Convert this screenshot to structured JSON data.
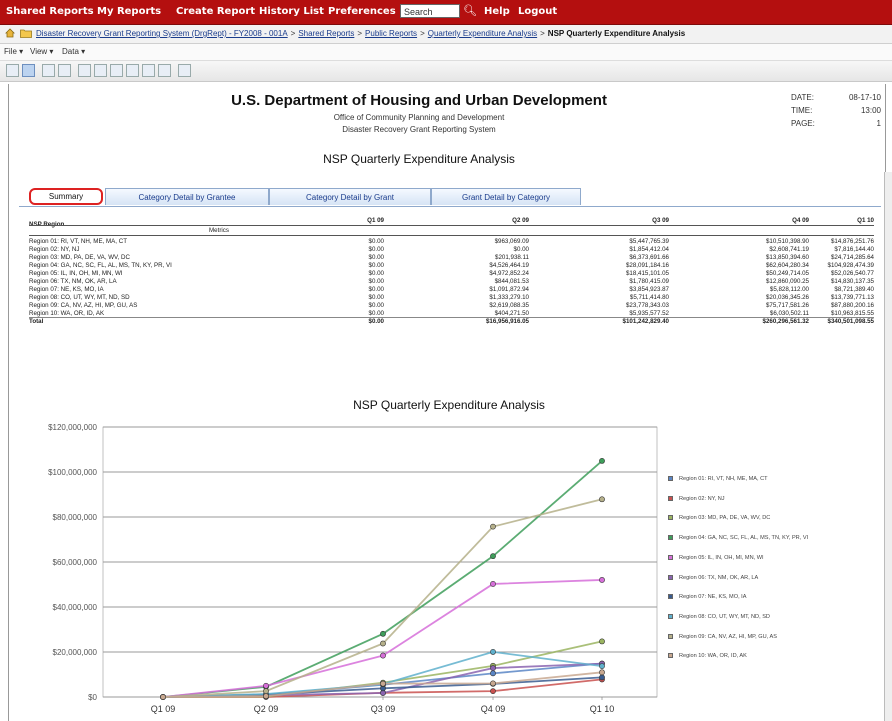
{
  "nav": {
    "items": [
      "Shared Reports",
      "My Reports",
      "Create Report",
      "History List",
      "Preferences"
    ],
    "search_placeholder": "Search",
    "help": "Help",
    "logout": "Logout"
  },
  "breadcrumb": {
    "links": [
      "Disaster Recovery Grant Reporting System (DrgRept) - FY2008 - 001A",
      "Shared Reports",
      "Public Reports",
      "Quarterly Expenditure Analysis"
    ],
    "current": "NSP Quarterly Expenditure Analysis",
    "separator": ">"
  },
  "menubar": {
    "file": "File ▾",
    "view": "View ▾",
    "data": "Data ▾"
  },
  "header": {
    "org": "U.S. Department of Housing and Urban Development",
    "office": "Office of Community Planning and Development",
    "system": "Disaster Recovery Grant Reporting System",
    "report_title": "NSP Quarterly Expenditure Analysis",
    "date_label": "DATE:",
    "date_value": "08-17-10",
    "time_label": "TIME:",
    "time_value": "13:00",
    "page_label": "PAGE:",
    "page_value": "1"
  },
  "tabs": [
    "Summary",
    "Category Detail by Grantee",
    "Category Detail by Grant",
    "Grant Detail by Category"
  ],
  "table": {
    "row_header": "NSP Region",
    "metrics_label": "Metrics",
    "columns": [
      "Q1 09",
      "Q2 09",
      "Q3 09",
      "Q4 09",
      "Q1 10"
    ],
    "rows": [
      {
        "region": "Region 01: RI, VT, NH, ME, MA, CT",
        "values": [
          "$0.00",
          "$963,069.09",
          "$5,447,765.39",
          "$10,510,398.90",
          "$14,876,251.76"
        ]
      },
      {
        "region": "Region 02: NY, NJ",
        "values": [
          "$0.00",
          "$0.00",
          "$1,854,412.04",
          "$2,608,741.19",
          "$7,816,144.40"
        ]
      },
      {
        "region": "Region 03: MD, PA, DE, VA, WV, DC",
        "values": [
          "$0.00",
          "$201,938.11",
          "$6,373,691.66",
          "$13,850,394.60",
          "$24,714,285.64"
        ]
      },
      {
        "region": "Region 04: GA, NC, SC, FL, AL, MS, TN, KY, PR, VI",
        "values": [
          "$0.00",
          "$4,526,464.19",
          "$28,091,184.16",
          "$62,604,280.34",
          "$104,928,474.39"
        ]
      },
      {
        "region": "Region 05: IL, IN, OH, MI, MN, WI",
        "values": [
          "$0.00",
          "$4,972,852.24",
          "$18,415,101.05",
          "$50,249,714.05",
          "$52,026,540.77"
        ]
      },
      {
        "region": "Region 06: TX, NM, OK, AR, LA",
        "values": [
          "$0.00",
          "$844,081.53",
          "$1,780,415.09",
          "$12,860,090.25",
          "$14,830,137.35"
        ]
      },
      {
        "region": "Region 07: NE, KS, MO, IA",
        "values": [
          "$0.00",
          "$1,091,872.94",
          "$3,854,923.87",
          "$5,828,112.00",
          "$8,721,389.40"
        ]
      },
      {
        "region": "Region 08: CO, UT, WY, MT, ND, SD",
        "values": [
          "$0.00",
          "$1,333,279.10",
          "$5,711,414.80",
          "$20,036,345.26",
          "$13,739,771.13"
        ]
      },
      {
        "region": "Region 09: CA, NV, AZ, HI, MP, GU, AS",
        "values": [
          "$0.00",
          "$2,619,088.35",
          "$23,778,343.03",
          "$75,717,581.26",
          "$87,880,200.16"
        ]
      },
      {
        "region": "Region 10: WA, OR, ID, AK",
        "values": [
          "$0.00",
          "$404,271.50",
          "$5,935,577.52",
          "$6,030,502.11",
          "$10,963,815.55"
        ]
      }
    ],
    "total": {
      "region": "Total",
      "values": [
        "$0.00",
        "$16,956,916.05",
        "$101,242,829.40",
        "$260,296,561.32",
        "$340,501,098.55"
      ]
    }
  },
  "chart_data": {
    "type": "line",
    "title": "NSP Quarterly Expenditure Analysis",
    "categories": [
      "Q1 09",
      "Q2 09",
      "Q3 09",
      "Q4 09",
      "Q1 10"
    ],
    "y_ticks": [
      "$0",
      "$20,000,000",
      "$40,000,000",
      "$60,000,000",
      "$80,000,000",
      "$100,000,000",
      "$120,000,000"
    ],
    "ylim": [
      0,
      120000000
    ],
    "grid": true,
    "legend_position": "right",
    "series": [
      {
        "name": "Region 01: RI, VT, NH, ME, MA, CT",
        "color": "#5b86c5",
        "values": [
          0,
          963069,
          5447765,
          10510399,
          14876252
        ]
      },
      {
        "name": "Region 02: NY, NJ",
        "color": "#c9514f",
        "values": [
          0,
          0,
          1854412,
          2608741,
          7816144
        ]
      },
      {
        "name": "Region 03: MD, PA, DE, VA, WV, DC",
        "color": "#9bb561",
        "values": [
          0,
          201938,
          6373692,
          13850395,
          24714286
        ]
      },
      {
        "name": "Region 04: GA, NC, SC, FL, AL, MS, TN, KY, PR, VI",
        "color": "#3e9e5a",
        "values": [
          0,
          4526464,
          28091184,
          62604280,
          104928474
        ]
      },
      {
        "name": "Region 05: IL, IN, OH, MI, MN, WI",
        "color": "#d66fd9",
        "values": [
          0,
          4972852,
          18415101,
          50249714,
          52026541
        ]
      },
      {
        "name": "Region 06: TX, NM, OK, AR, LA",
        "color": "#8a64b0",
        "values": [
          0,
          844082,
          1780415,
          12860090,
          14830137
        ]
      },
      {
        "name": "Region 07: NE, KS, MO, IA",
        "color": "#3a5c8f",
        "values": [
          0,
          1091873,
          3854924,
          5828112,
          8721389
        ]
      },
      {
        "name": "Region 08: CO, UT, WY, MT, ND, SD",
        "color": "#5fb0cc",
        "values": [
          0,
          1333279,
          5711415,
          20036345,
          13739771
        ]
      },
      {
        "name": "Region 09: CA, NV, AZ, HI, MP, GU, AS",
        "color": "#b5b08a",
        "values": [
          0,
          2619088,
          23778343,
          75717581,
          87880200
        ]
      },
      {
        "name": "Region 10: WA, OR, ID, AK",
        "color": "#c8a890",
        "values": [
          0,
          404272,
          5935578,
          6030502,
          10963816
        ]
      }
    ]
  },
  "legend_labels": [
    "Region 01: RI, VT, NH, ME, MA, CT",
    "Region 02: NY, NJ",
    "Region 03: MD, PA, DE, VA, WV, DC",
    "Region 04: GA, NC, SC, FL, AL, MS, TN, KY, PR, VI",
    "Region 05: IL, IN, OH, MI, MN, WI",
    "Region 06: TX, NM, OK, AR, LA",
    "Region 07: NE, KS, MO, IA",
    "Region 08: CO, UT, WY, MT, ND, SD",
    "Region 09: CA, NV, AZ, HI, MP, GU, AS",
    "Region 10: WA, OR, ID, AK"
  ]
}
